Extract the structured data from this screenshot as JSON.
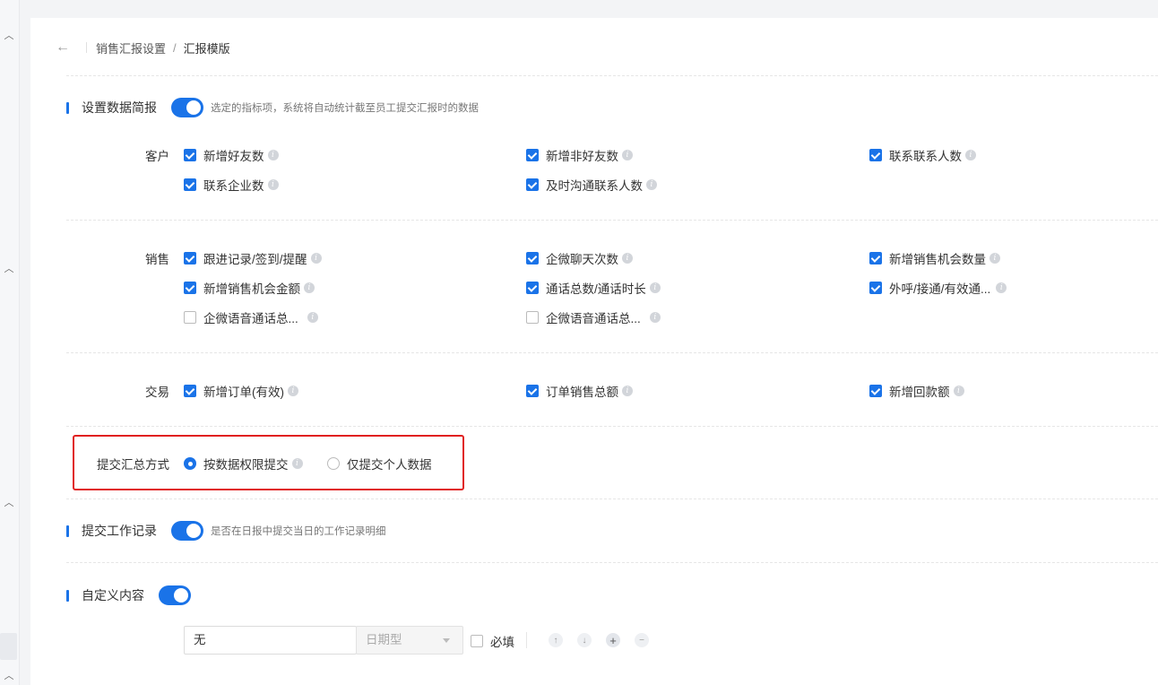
{
  "breadcrumb": {
    "parent": "销售汇报设置",
    "separator": "/",
    "current": "汇报模版"
  },
  "data_brief": {
    "title": "设置数据简报",
    "enabled": true,
    "description": "选定的指标项，系统将自动统计截至员工提交汇报时的数据",
    "groups": {
      "customer": {
        "label": "客户",
        "items": [
          {
            "label": "新增好友数",
            "checked": true
          },
          {
            "label": "新增非好友数",
            "checked": true
          },
          {
            "label": "联系联系人数",
            "checked": true
          },
          {
            "label": "联系企业数",
            "checked": true
          },
          {
            "label": "及时沟通联系人数",
            "checked": true
          }
        ]
      },
      "sales": {
        "label": "销售",
        "items": [
          {
            "label": "跟进记录/签到/提醒",
            "checked": true
          },
          {
            "label": "企微聊天次数",
            "checked": true
          },
          {
            "label": "新增销售机会数量",
            "checked": true
          },
          {
            "label": "新增销售机会金额",
            "checked": true
          },
          {
            "label": "通话总数/通话时长",
            "checked": true
          },
          {
            "label": "外呼/接通/有效通...",
            "checked": true
          },
          {
            "label": "企微语音通话总...",
            "checked": false
          },
          {
            "label": "企微语音通话总...",
            "checked": false
          }
        ]
      },
      "trade": {
        "label": "交易",
        "items": [
          {
            "label": "新增订单(有效)",
            "checked": true
          },
          {
            "label": "订单销售总额",
            "checked": true
          },
          {
            "label": "新增回款额",
            "checked": true
          }
        ]
      }
    }
  },
  "submit_mode": {
    "label": "提交汇总方式",
    "options": [
      {
        "label": "按数据权限提交",
        "selected": true
      },
      {
        "label": "仅提交个人数据",
        "selected": false
      }
    ]
  },
  "work_record": {
    "title": "提交工作记录",
    "enabled": true,
    "description": "是否在日报中提交当日的工作记录明细"
  },
  "custom_content": {
    "title": "自定义内容",
    "enabled": true,
    "field_value": "无",
    "type_placeholder": "日期型",
    "required_label": "必填",
    "required": false
  },
  "colors": {
    "accent": "#1a73e8",
    "highlight_box": "#e02020"
  },
  "icons": [
    "back-arrow-icon",
    "info-icon",
    "chevron-up-icon",
    "arrow-up-icon",
    "arrow-down-icon",
    "plus-icon",
    "minus-icon"
  ]
}
